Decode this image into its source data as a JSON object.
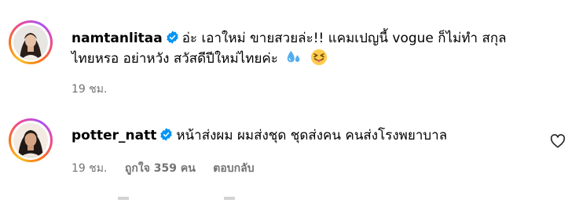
{
  "comments": [
    {
      "username": "namtanlitaa",
      "text_line1": "อ่ะ เอาใหม่ ขายสวยล่ะ!! แคมเปญนี้ vogue ก็ไม่ทำ สกุล",
      "text_line2": "ไทยหรอ อย่าหวัง สวัสดีปีใหม่ไทยค่ะ",
      "emojis": [
        "sweat-droplets-emoji",
        "squinting-tongue-emoji"
      ],
      "time": "19 ชม."
    },
    {
      "username": "potter_natt",
      "text": "หน้าส่งผม ผมส่งชุด ชุดส่งคน คนส่งโรงพยาบาล",
      "time": "19 ชม.",
      "likes": "ถูกใจ 359 คน",
      "reply": "ตอบกลับ"
    }
  ],
  "colors": {
    "verified": "#0095f6",
    "meta": "#737373"
  }
}
